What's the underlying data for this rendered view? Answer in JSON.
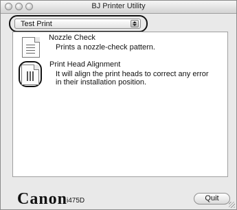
{
  "window": {
    "title": "BJ Printer Utility"
  },
  "popup": {
    "selected": "Test Print"
  },
  "items": [
    {
      "title": "Nozzle Check",
      "description": "Prints a nozzle-check pattern."
    },
    {
      "title": "Print Head Alignment",
      "description_lines": [
        "It will align the print heads to correct any error",
        "in their installation position."
      ]
    }
  ],
  "footer": {
    "brand": "Canon",
    "model": "i475D",
    "quit_label": "Quit"
  },
  "icons": [
    "close-light-icon",
    "minimize-light-icon",
    "zoom-light-icon",
    "nozzle-check-icon",
    "print-head-alignment-icon",
    "resize-grip-icon"
  ]
}
